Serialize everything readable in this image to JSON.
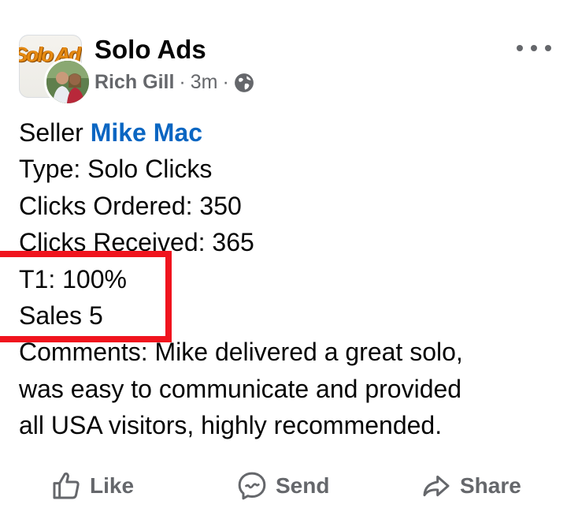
{
  "post": {
    "group_name": "Solo Ads",
    "group_logo_text": "Solo Ad",
    "author": "Rich Gill",
    "separator": "·",
    "time": "3m",
    "lines": {
      "seller_prefix": "Seller",
      "seller_name": "Mike Mac",
      "type": "Type: Solo Clicks",
      "clicks_ordered": "Clicks Ordered: 350",
      "clicks_received": "Clicks Received: 365",
      "t1": "T1: 100%",
      "sales": "Sales 5",
      "comments_1": "Comments:  Mike delivered a great solo,",
      "comments_2": "was easy to communicate and provided",
      "comments_3": "all USA visitors, highly recommended."
    }
  },
  "actions": {
    "like": "Like",
    "send": "Send",
    "share": "Share"
  },
  "colors": {
    "link": "#0a66c2",
    "meta": "#65676b",
    "highlight": "#f0141e"
  },
  "icons": [
    "globe-icon",
    "more-options-icon",
    "thumbs-up-icon",
    "messenger-icon",
    "share-arrow-icon"
  ]
}
